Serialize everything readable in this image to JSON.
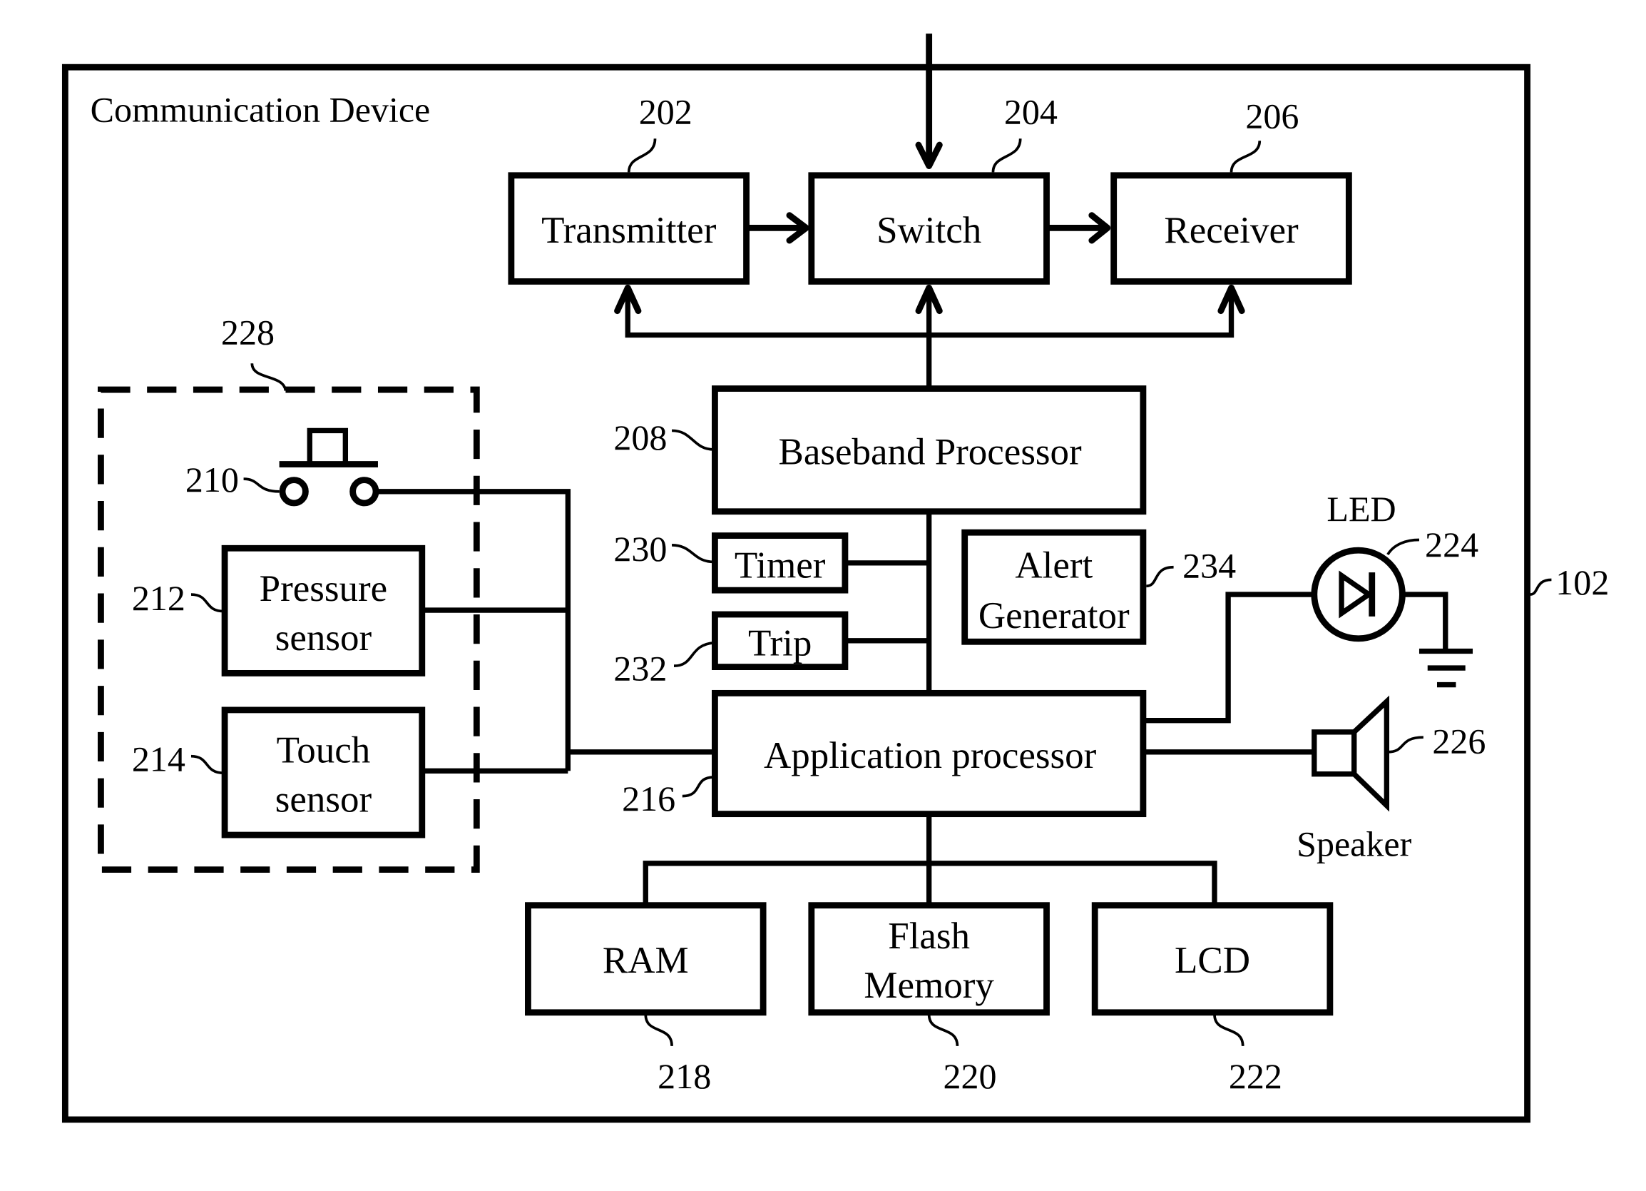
{
  "diagram": {
    "title": "Communication Device",
    "device_ref": "102",
    "blocks": {
      "transmitter": {
        "label": "Transmitter",
        "ref": "202"
      },
      "switch": {
        "label": "Switch",
        "ref": "204"
      },
      "receiver": {
        "label": "Receiver",
        "ref": "206"
      },
      "baseband": {
        "label": "Baseband Processor",
        "ref": "208"
      },
      "button": {
        "ref": "210"
      },
      "pressure": {
        "label_line1": "Pressure",
        "label_line2": "sensor",
        "ref": "212"
      },
      "touch": {
        "label_line1": "Touch",
        "label_line2": "sensor",
        "ref": "214"
      },
      "app": {
        "label": "Application processor",
        "ref": "216"
      },
      "ram": {
        "label": "RAM",
        "ref": "218"
      },
      "flash": {
        "label_line1": "Flash",
        "label_line2": "Memory",
        "ref": "220"
      },
      "lcd": {
        "label": "LCD",
        "ref": "222"
      },
      "led": {
        "label": "LED",
        "ref": "224"
      },
      "speaker": {
        "label": "Speaker",
        "ref": "226"
      },
      "sensor_group": {
        "ref": "228"
      },
      "timer": {
        "label": "Timer",
        "ref": "230"
      },
      "trip": {
        "label": "Trip",
        "ref": "232"
      },
      "alert": {
        "label_line1": "Alert",
        "label_line2": "Generator",
        "ref": "234"
      }
    }
  }
}
